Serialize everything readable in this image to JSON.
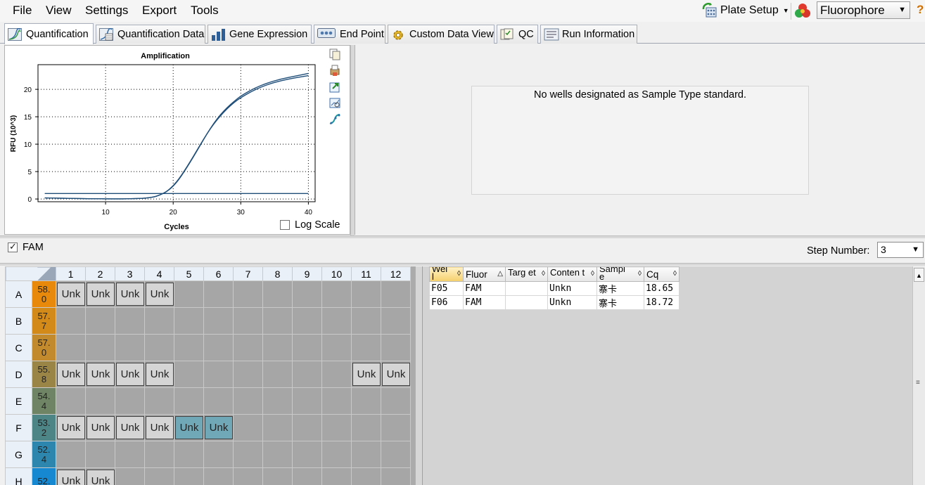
{
  "menu": {
    "file": "File",
    "view": "View",
    "settings": "Settings",
    "export": "Export",
    "tools": "Tools"
  },
  "toolbar": {
    "plate_setup": "Plate Setup",
    "fluorophore": "Fluorophore"
  },
  "tabs": {
    "quantification": "Quantification",
    "quantification_data": "Quantification Data",
    "gene_expression": "Gene Expression",
    "end_point": "End Point",
    "custom_data_view": "Custom Data View",
    "qc": "QC",
    "run_information": "Run Information"
  },
  "chart_data": {
    "type": "line",
    "title": "Amplification",
    "xlabel": "Cycles",
    "ylabel": "RFU (10^3)",
    "xlim": [
      0,
      41
    ],
    "ylim": [
      -0.5,
      24.5
    ],
    "xticks": [
      "10",
      "20",
      "30",
      "40"
    ],
    "yticks": [
      "0",
      "5",
      "10",
      "15",
      "20"
    ],
    "grid": true,
    "series_color": "#1f4e79",
    "series": [
      {
        "x": [
          1,
          5,
          10,
          15,
          17,
          18,
          19,
          20,
          21,
          22,
          23,
          24,
          25,
          26,
          27,
          28,
          29,
          30,
          32,
          34,
          36,
          38,
          40
        ],
        "y": [
          0.2,
          0.1,
          0.0,
          0.05,
          0.3,
          0.7,
          1.3,
          2.4,
          3.9,
          5.8,
          7.8,
          9.9,
          11.9,
          13.7,
          15.2,
          16.5,
          17.6,
          18.5,
          19.9,
          20.9,
          21.6,
          22.1,
          22.5
        ]
      },
      {
        "x": [
          1,
          5,
          10,
          15,
          17,
          18,
          19,
          20,
          21,
          22,
          23,
          24,
          25,
          26,
          27,
          28,
          29,
          30,
          32,
          34,
          36,
          38,
          40
        ],
        "y": [
          0.2,
          0.1,
          0.0,
          0.05,
          0.3,
          0.7,
          1.3,
          2.3,
          3.8,
          5.7,
          7.7,
          9.8,
          11.9,
          13.8,
          15.4,
          16.7,
          17.8,
          18.8,
          20.2,
          21.2,
          21.9,
          22.4,
          22.9
        ]
      },
      {
        "x": [
          1,
          40
        ],
        "y": [
          1.0,
          1.0
        ]
      }
    ],
    "log_scale": false
  },
  "chart_panel": {
    "log_scale_label": "Log Scale"
  },
  "std_panel": {
    "message": "No wells designated as Sample Type standard."
  },
  "fam": {
    "label": "FAM",
    "checked": true
  },
  "step": {
    "label": "Step Number:",
    "value": "3"
  },
  "plate": {
    "columns": [
      "1",
      "2",
      "3",
      "4",
      "5",
      "6",
      "7",
      "8",
      "9",
      "10",
      "11",
      "12"
    ],
    "rows": [
      {
        "label": "A",
        "temp": "58.0",
        "temp_color": "#e8890c",
        "wells": [
          "Unk",
          "Unk",
          "Unk",
          "Unk",
          "",
          "",
          "",
          "",
          "",
          "",
          "",
          ""
        ],
        "sel": []
      },
      {
        "label": "B",
        "temp": "57.7",
        "temp_color": "#d48a18",
        "wells": [
          "",
          "",
          "",
          "",
          "",
          "",
          "",
          "",
          "",
          "",
          "",
          ""
        ],
        "sel": []
      },
      {
        "label": "C",
        "temp": "57.0",
        "temp_color": "#c28a2c",
        "wells": [
          "",
          "",
          "",
          "",
          "",
          "",
          "",
          "",
          "",
          "",
          "",
          ""
        ],
        "sel": []
      },
      {
        "label": "D",
        "temp": "55.8",
        "temp_color": "#9a8546",
        "wells": [
          "Unk",
          "Unk",
          "Unk",
          "Unk",
          "",
          "",
          "",
          "",
          "",
          "",
          "Unk",
          "Unk"
        ],
        "sel": []
      },
      {
        "label": "E",
        "temp": "54.4",
        "temp_color": "#6f8464",
        "wells": [
          "",
          "",
          "",
          "",
          "",
          "",
          "",
          "",
          "",
          "",
          "",
          ""
        ],
        "sel": []
      },
      {
        "label": "F",
        "temp": "53.2",
        "temp_color": "#4d8486",
        "wells": [
          "Unk",
          "Unk",
          "Unk",
          "Unk",
          "Unk",
          "Unk",
          "",
          "",
          "",
          "",
          "",
          ""
        ],
        "sel": [
          4,
          5
        ]
      },
      {
        "label": "G",
        "temp": "52.4",
        "temp_color": "#2d86ad",
        "wells": [
          "",
          "",
          "",
          "",
          "",
          "",
          "",
          "",
          "",
          "",
          "",
          ""
        ],
        "sel": []
      },
      {
        "label": "H",
        "temp": "52.",
        "temp_color": "#1688d2",
        "wells": [
          "Unk",
          "Unk",
          "",
          "",
          "",
          "",
          "",
          "",
          "",
          "",
          "",
          ""
        ],
        "sel": []
      }
    ]
  },
  "results": {
    "headers": [
      "Wel l",
      "Fluor",
      "Targ et",
      "Conten t",
      "Sampl e",
      "Cq"
    ],
    "rows": [
      [
        "F05",
        "FAM",
        "",
        "Unkn",
        "寨卡",
        "18.65"
      ],
      [
        "F06",
        "FAM",
        "",
        "Unkn",
        "寨卡",
        "18.72"
      ]
    ]
  }
}
